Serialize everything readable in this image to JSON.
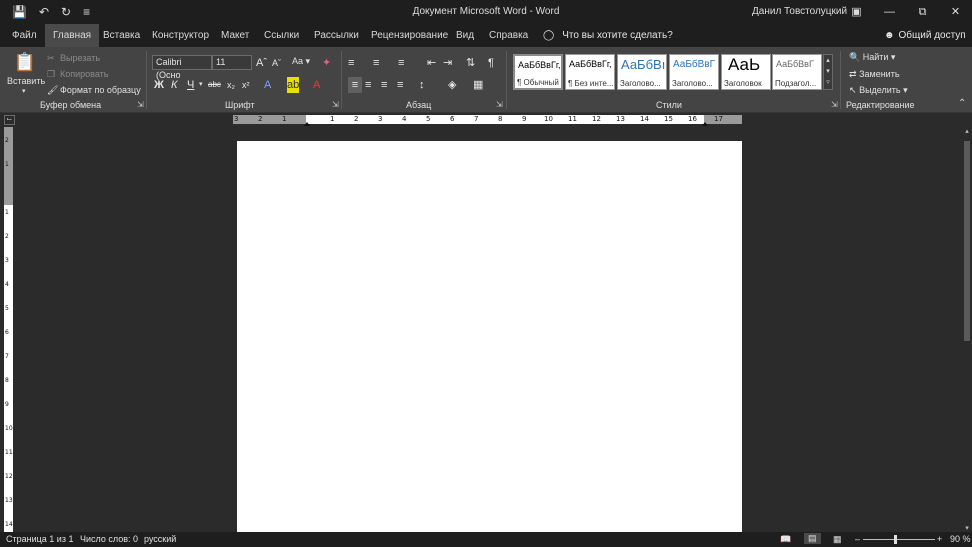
{
  "titlebar": {
    "qat": {
      "save_icon": "save-icon",
      "undo_icon": "undo-icon",
      "redo_icon": "redo-icon",
      "customize_icon": "customize-qat-icon"
    },
    "title": "Документ Microsoft Word  -  Word",
    "user": "Данил Товстолуцкий"
  },
  "tabs": {
    "items": [
      "Файл",
      "Главная",
      "Вставка",
      "Конструктор",
      "Макет",
      "Ссылки",
      "Рассылки",
      "Рецензирование",
      "Вид",
      "Справка"
    ],
    "active": "Главная",
    "tell_me": "Что вы хотите сделать?",
    "share": "Общий доступ"
  },
  "ribbon": {
    "clipboard": {
      "label": "Буфер обмена",
      "paste": "Вставить",
      "cut": "Вырезать",
      "copy": "Копировать",
      "format_painter": "Формат по образцу"
    },
    "font": {
      "label": "Шрифт",
      "font_name": "Calibri (Осно",
      "font_size": "11",
      "change_case": "Aa"
    },
    "paragraph": {
      "label": "Абзац"
    },
    "styles": {
      "label": "Стили",
      "items": [
        {
          "sample": "АаБбВвГг,",
          "name": "¶ Обычный"
        },
        {
          "sample": "АаБбВвГг,",
          "name": "¶ Без инте..."
        },
        {
          "sample": "АаБбВı",
          "name": "Заголово..."
        },
        {
          "sample": "АаБбВвГ",
          "name": "Заголово..."
        },
        {
          "sample": "АаЬ",
          "name": "Заголовок"
        },
        {
          "sample": "АаБбВвГ",
          "name": "Подзагол..."
        }
      ]
    },
    "editing": {
      "label": "Редактирование",
      "find": "Найти",
      "replace": "Заменить",
      "select": "Выделить"
    }
  },
  "ruler": {
    "ticks": [
      "3",
      "2",
      "1",
      "1",
      "2",
      "3",
      "4",
      "5",
      "6",
      "7",
      "8",
      "9",
      "10",
      "11",
      "12",
      "13",
      "14",
      "15",
      "16",
      "17"
    ],
    "vticks": [
      "2",
      "1",
      "1",
      "2",
      "3",
      "4",
      "5",
      "6",
      "7",
      "8",
      "9",
      "10",
      "11",
      "12",
      "13",
      "14"
    ]
  },
  "status": {
    "page": "Страница 1 из 1",
    "words": "Число слов: 0",
    "language": "русский",
    "zoom": "90 %"
  }
}
